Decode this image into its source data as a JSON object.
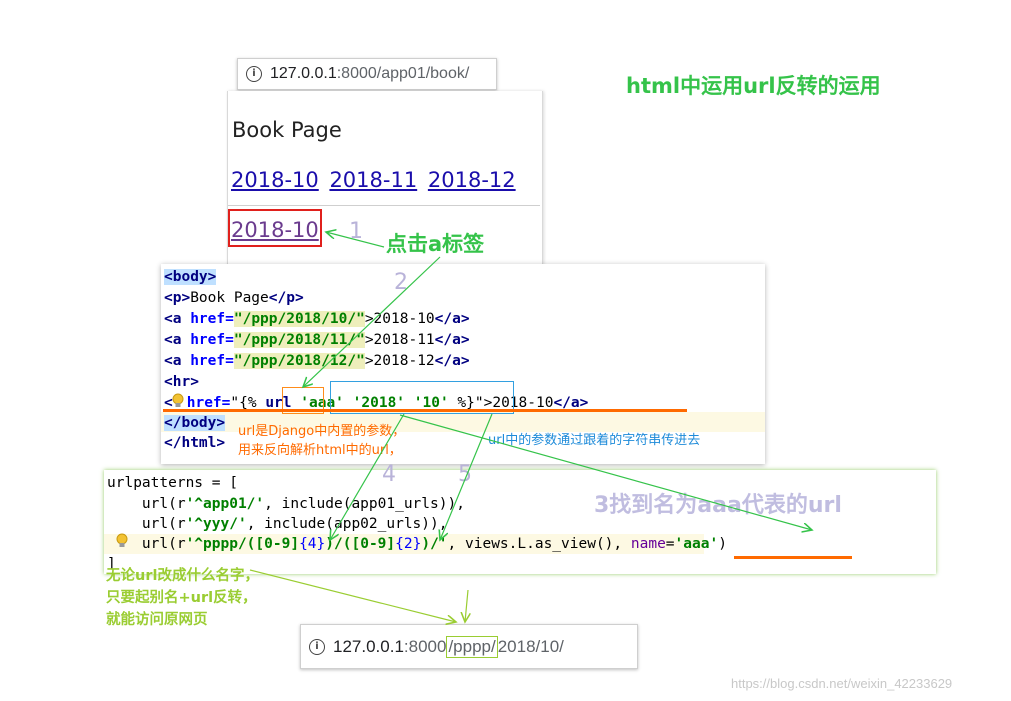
{
  "title": "html中运用url反转的运用",
  "top_address_bar": {
    "host": "127.0.0.1",
    "rest": ":8000/app01/book/"
  },
  "book_page": {
    "heading": "Book Page",
    "links": [
      "2018-10",
      "2018-11",
      "2018-12"
    ],
    "clicked_link": "2018-10"
  },
  "annotations": {
    "step1_number": "1",
    "click_label": "点击a标签",
    "step2_number": "2",
    "url_note_line1": "url是Django中内置的参数，",
    "url_note_line2": "用来反向解析html中的url，",
    "param_note": "url中的参数通过跟着的字符串传进去",
    "step4_number": "4",
    "step5_number": "5",
    "find_label": "3找到名为aaa代表的url",
    "alias_note_line1": "无论url改成什么名字，",
    "alias_note_line2": "只要起别名+url反转，",
    "alias_note_line3": "就能访问原网页"
  },
  "html_code": {
    "body_open": "<body>",
    "p_open": "<p>",
    "p_text": "Book Page",
    "p_close": "</p>",
    "a_open": "<a",
    "href_attr": "href=",
    "a_close": "</a>",
    "gt": ">",
    "href1": "\"/ppp/2018/10/\"",
    "text1": "2018-10",
    "href2": "\"/ppp/2018/11/\"",
    "text2": "2018-11",
    "href3": "\"/ppp/2018/12/\"",
    "text3": "2018-12",
    "hr": "<hr>",
    "lt": "<",
    "tpl_open": "{%",
    "url_kw": "url",
    "args": "'aaa' '2018' '10'",
    "tpl_close": "%}\"",
    "text4": "2018-10",
    "body_close": "</body>",
    "html_close": "</html>"
  },
  "py_code": {
    "line1": "urlpatterns = [",
    "l2_a": "    url(r",
    "l2_s": "'^app01/'",
    "l2_b": ", include(app01_urls)),",
    "l3_a": "    url(r",
    "l3_s": "'^yyy/'",
    "l3_b": ", include(app02_urls)),",
    "l4_a": "    url(r",
    "l4_s1": "'^pppp/(",
    "l4_s2": "[0-9]",
    "l4_n1": "{4}",
    "l4_s3": ")/(",
    "l4_s4": "[0-9]",
    "l4_n2": "{2}",
    "l4_s5": ")/'",
    "l4_b": ", views.L.as_view(), ",
    "l4_kw": "name",
    "l4_eq": "=",
    "l4_name": "'aaa'",
    "l4_c": ")",
    "line5": "]"
  },
  "bottom_address_bar": {
    "host": "127.0.0.1",
    "port": ":8000",
    "prefix": "/pppp/",
    "rest": "2018/10/"
  },
  "watermark": "https://blog.csdn.net/weixin_42233629",
  "colors": {
    "green": "#35c34a",
    "orange": "#ff6a00",
    "blue": "#1e8bd9",
    "yellowgreen": "#9acd32",
    "red": "#e0201c"
  }
}
